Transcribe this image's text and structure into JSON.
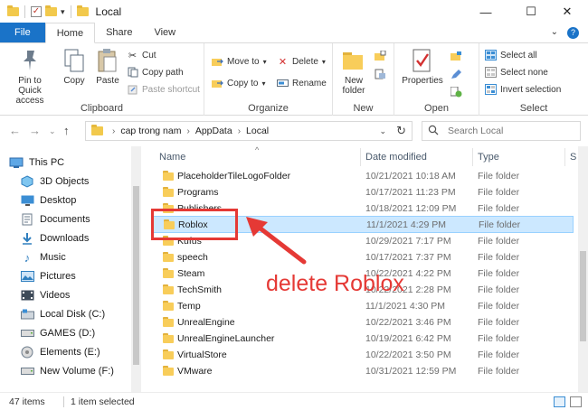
{
  "window": {
    "title": "Local",
    "minimize": "—",
    "maximize": "☐",
    "close": "✕"
  },
  "tabs": [
    "File",
    "Home",
    "Share",
    "View"
  ],
  "ribbon": {
    "clipboard": {
      "label": "Clipboard",
      "pin": "Pin to Quick access",
      "copy": "Copy",
      "paste": "Paste",
      "cut": "Cut",
      "copy_path": "Copy path",
      "paste_shortcut": "Paste shortcut"
    },
    "organize": {
      "label": "Organize",
      "move_to": "Move to",
      "copy_to": "Copy to",
      "delete": "Delete",
      "rename": "Rename"
    },
    "new": {
      "label": "New",
      "new_folder": "New folder"
    },
    "open": {
      "label": "Open",
      "properties": "Properties"
    },
    "select": {
      "label": "Select",
      "select_all": "Select all",
      "select_none": "Select none",
      "invert": "Invert selection"
    }
  },
  "address": {
    "crumbs": [
      "cap trong nam",
      "AppData",
      "Local"
    ]
  },
  "search": {
    "placeholder": "Search Local"
  },
  "nav": [
    {
      "label": "This PC",
      "icon": "this-pc-icon"
    },
    {
      "label": "3D Objects",
      "icon": "3d-objects-icon"
    },
    {
      "label": "Desktop",
      "icon": "desktop-icon"
    },
    {
      "label": "Documents",
      "icon": "documents-icon"
    },
    {
      "label": "Downloads",
      "icon": "downloads-icon"
    },
    {
      "label": "Music",
      "icon": "music-icon"
    },
    {
      "label": "Pictures",
      "icon": "pictures-icon"
    },
    {
      "label": "Videos",
      "icon": "videos-icon"
    },
    {
      "label": "Local Disk (C:)",
      "icon": "local-disk-icon"
    },
    {
      "label": "GAMES (D:)",
      "icon": "drive-icon"
    },
    {
      "label": "Elements (E:)",
      "icon": "drive-icon"
    },
    {
      "label": "New Volume (F:)",
      "icon": "drive-icon"
    }
  ],
  "columns": {
    "name": "Name",
    "date": "Date modified",
    "type": "Type",
    "size": "S"
  },
  "files": [
    {
      "name": "PlaceholderTileLogoFolder",
      "date": "10/21/2021 10:18 AM",
      "type": "File folder"
    },
    {
      "name": "Programs",
      "date": "10/17/2021 11:23 PM",
      "type": "File folder"
    },
    {
      "name": "Publishers",
      "date": "10/18/2021 12:09 PM",
      "type": "File folder"
    },
    {
      "name": "Roblox",
      "date": "11/1/2021 4:29 PM",
      "type": "File folder",
      "selected": true
    },
    {
      "name": "Kufus",
      "date": "10/29/2021 7:17 PM",
      "type": "File folder"
    },
    {
      "name": "speech",
      "date": "10/17/2021 7:37 PM",
      "type": "File folder"
    },
    {
      "name": "Steam",
      "date": "10/22/2021 4:22 PM",
      "type": "File folder"
    },
    {
      "name": "TechSmith",
      "date": "10/22/2021 2:28 PM",
      "type": "File folder"
    },
    {
      "name": "Temp",
      "date": "11/1/2021 4:30 PM",
      "type": "File folder"
    },
    {
      "name": "UnrealEngine",
      "date": "10/22/2021 3:46 PM",
      "type": "File folder"
    },
    {
      "name": "UnrealEngineLauncher",
      "date": "10/19/2021 6:42 PM",
      "type": "File folder"
    },
    {
      "name": "VirtualStore",
      "date": "10/22/2021 3:50 PM",
      "type": "File folder"
    },
    {
      "name": "VMware",
      "date": "10/31/2021 12:59 PM",
      "type": "File folder"
    }
  ],
  "annotation": {
    "text": "delete Roblox",
    "color": "#e53935"
  },
  "status": {
    "count": "47 items",
    "selected": "1 item selected"
  },
  "colors": {
    "accent": "#1a73c8",
    "selection": "#cce8ff",
    "folder": "#f8cd5a"
  }
}
